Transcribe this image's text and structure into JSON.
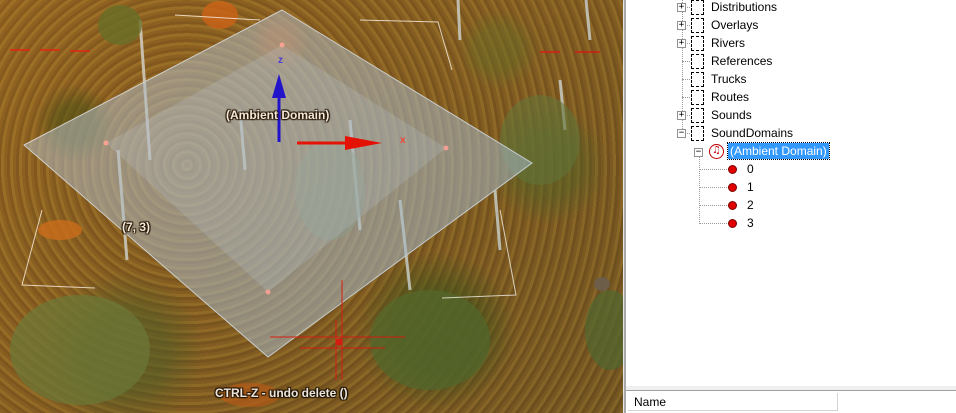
{
  "viewport": {
    "selected_object_label": "(Ambient Domain)",
    "coordinate_label": "(7, 3)",
    "status_message": "CTRL-Z - undo delete ()",
    "gizmo": {
      "z_axis_label": "z",
      "x_axis_label": "x"
    }
  },
  "tree": {
    "items": [
      {
        "label": "Distributions",
        "expandable": true
      },
      {
        "label": "Overlays",
        "expandable": true
      },
      {
        "label": "Rivers",
        "expandable": true
      },
      {
        "label": "References",
        "expandable": false
      },
      {
        "label": "Trucks",
        "expandable": false
      },
      {
        "label": "Routes",
        "expandable": false
      },
      {
        "label": "Sounds",
        "expandable": true
      },
      {
        "label": "SoundDomains",
        "expandable": true,
        "expanded": true
      }
    ],
    "selected": {
      "label": "(Ambient Domain)",
      "icon": "sound-note-icon"
    },
    "points": [
      "0",
      "1",
      "2",
      "3"
    ]
  },
  "properties": {
    "column_name": "Name"
  },
  "colors": {
    "selection": "#3399ff",
    "point_marker": "#e00000",
    "gizmo_z": "#0000ee",
    "gizmo_x": "#ee0000",
    "domain_overlay": "#a8c8e8"
  }
}
